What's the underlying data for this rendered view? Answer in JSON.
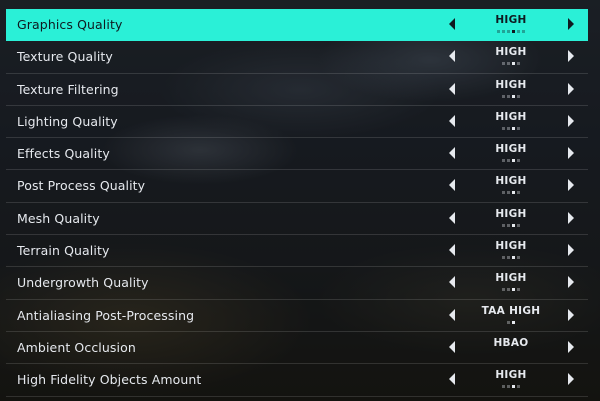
{
  "settings": [
    {
      "name": "graphics-quality",
      "label": "Graphics Quality",
      "value": "HIGH",
      "options_count": 6,
      "selected_index": 3,
      "selected": true
    },
    {
      "name": "texture-quality",
      "label": "Texture Quality",
      "value": "HIGH",
      "options_count": 4,
      "selected_index": 2,
      "selected": false
    },
    {
      "name": "texture-filtering",
      "label": "Texture Filtering",
      "value": "HIGH",
      "options_count": 4,
      "selected_index": 2,
      "selected": false
    },
    {
      "name": "lighting-quality",
      "label": "Lighting Quality",
      "value": "HIGH",
      "options_count": 4,
      "selected_index": 2,
      "selected": false
    },
    {
      "name": "effects-quality",
      "label": "Effects Quality",
      "value": "HIGH",
      "options_count": 4,
      "selected_index": 2,
      "selected": false
    },
    {
      "name": "post-process-quality",
      "label": "Post Process Quality",
      "value": "HIGH",
      "options_count": 4,
      "selected_index": 2,
      "selected": false
    },
    {
      "name": "mesh-quality",
      "label": "Mesh Quality",
      "value": "HIGH",
      "options_count": 4,
      "selected_index": 2,
      "selected": false
    },
    {
      "name": "terrain-quality",
      "label": "Terrain Quality",
      "value": "HIGH",
      "options_count": 4,
      "selected_index": 2,
      "selected": false
    },
    {
      "name": "undergrowth-quality",
      "label": "Undergrowth Quality",
      "value": "HIGH",
      "options_count": 4,
      "selected_index": 2,
      "selected": false
    },
    {
      "name": "antialiasing-post-processing",
      "label": "Antialiasing Post-Processing",
      "value": "TAA HIGH",
      "options_count": 2,
      "selected_index": 1,
      "selected": false
    },
    {
      "name": "ambient-occlusion",
      "label": "Ambient Occlusion",
      "value": "HBAO",
      "options_count": 0,
      "selected_index": 0,
      "selected": false
    },
    {
      "name": "high-fidelity-objects-amount",
      "label": "High Fidelity Objects Amount",
      "value": "HIGH",
      "options_count": 4,
      "selected_index": 2,
      "selected": false
    }
  ],
  "icons": {
    "previous": "caret-left-icon",
    "next": "caret-right-icon"
  },
  "colors": {
    "highlight": "#2af0d7",
    "text": "#e6e9ee",
    "highlight_text": "#0f1a20"
  }
}
